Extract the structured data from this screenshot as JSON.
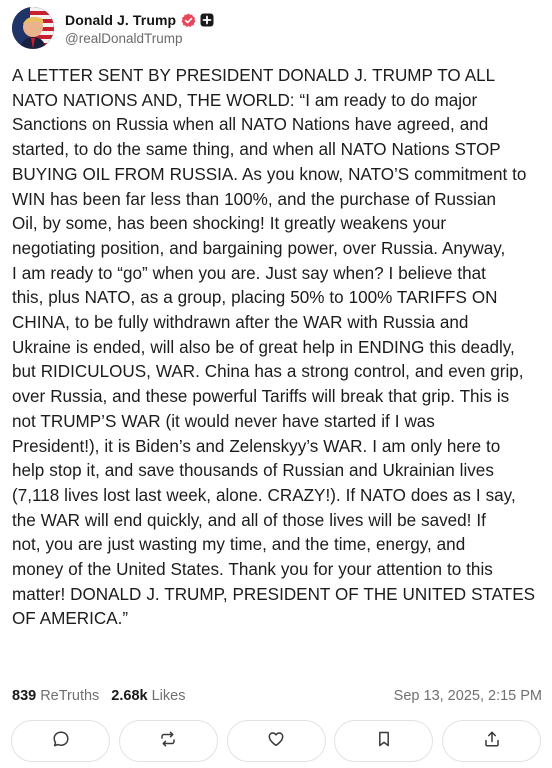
{
  "author": {
    "display_name": "Donald J. Trump",
    "handle": "@realDonaldTrump"
  },
  "post": {
    "text": "A LETTER SENT BY PRESIDENT DONALD J. TRUMP TO ALL\nNATO NATIONS AND, THE WORLD: “I am ready to do major\nSanctions on Russia when all NATO Nations have agreed, and\nstarted, to do the same thing, and when all NATO Nations STOP\nBUYING OIL FROM RUSSIA. As you know, NATO’S commitment to\nWIN has been far less than 100%, and the purchase of Russian\nOil, by some, has been shocking! It greatly weakens your\nnegotiating position, and bargaining power, over Russia. Anyway,\nI am ready to “go” when you are. Just say when? I believe that\nthis, plus NATO, as a group, placing 50% to 100% TARIFFS ON\nCHINA, to be fully withdrawn after the WAR with Russia and\nUkraine is ended, will also be of great help in ENDING this deadly,\nbut RIDICULOUS, WAR. China has a strong control, and even grip,\nover Russia, and these powerful Tariffs will break that grip. This is\nnot TRUMP’S WAR (it would never have  started if I was\nPresident!), it is Biden’s and Zelenskyy’s WAR. I am only here to\nhelp stop it, and save thousands of Russian and Ukrainian lives\n(7,118 lives lost last week, alone. CRAZY!). If NATO does as I say,\nthe WAR will end quickly, and all of those lives will be saved! If\nnot, you are just wasting my time, and the time, energy, and\nmoney of the United States. Thank you for your attention to this\nmatter! DONALD J. TRUMP, PRESIDENT OF THE UNITED STATES\nOF AMERICA.”"
  },
  "stats": {
    "retruths_count": "839",
    "retruths_label": "ReTruths",
    "likes_count": "2.68k",
    "likes_label": "Likes",
    "timestamp": "Sep 13, 2025, 2:15 PM"
  },
  "actions": [
    {
      "icon": "reply-icon"
    },
    {
      "icon": "retruth-icon"
    },
    {
      "icon": "like-icon"
    },
    {
      "icon": "bookmark-icon"
    },
    {
      "icon": "share-icon"
    }
  ],
  "colors": {
    "verified_badge": "#e8465a",
    "text": "#1c1c1c",
    "muted": "#707070",
    "border": "#e2e2e2"
  }
}
